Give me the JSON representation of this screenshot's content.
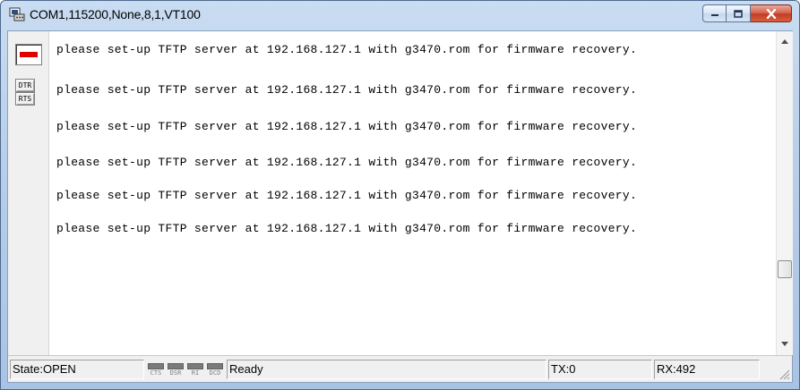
{
  "window": {
    "title": "COM1,115200,None,8,1,VT100",
    "controls": {
      "minimize": "minimize",
      "maximize": "maximize",
      "close": "close"
    }
  },
  "signals": {
    "dtr": "DTR",
    "rts": "RTS"
  },
  "terminal": {
    "lines": [
      "please set-up TFTP server at 192.168.127.1 with g3470.rom for firmware recovery.",
      "please set-up TFTP server at 192.168.127.1 with g3470.rom for firmware recovery.",
      "please set-up TFTP server at 192.168.127.1 with g3470.rom for firmware recovery.",
      "please set-up TFTP server at 192.168.127.1 with g3470.rom for firmware recovery.",
      "please set-up TFTP server at 192.168.127.1 with g3470.rom for firmware recovery.",
      "please set-up TFTP server at 192.168.127.1 with g3470.rom for firmware recovery."
    ]
  },
  "status": {
    "state": "State:OPEN",
    "leds": [
      "CTS",
      "DSR",
      "RI",
      "DCD"
    ],
    "message": "Ready",
    "tx": "TX:0",
    "rx": "RX:492"
  },
  "colors": {
    "signal_indicator": "#e00000",
    "close_button": "#c33d23"
  }
}
